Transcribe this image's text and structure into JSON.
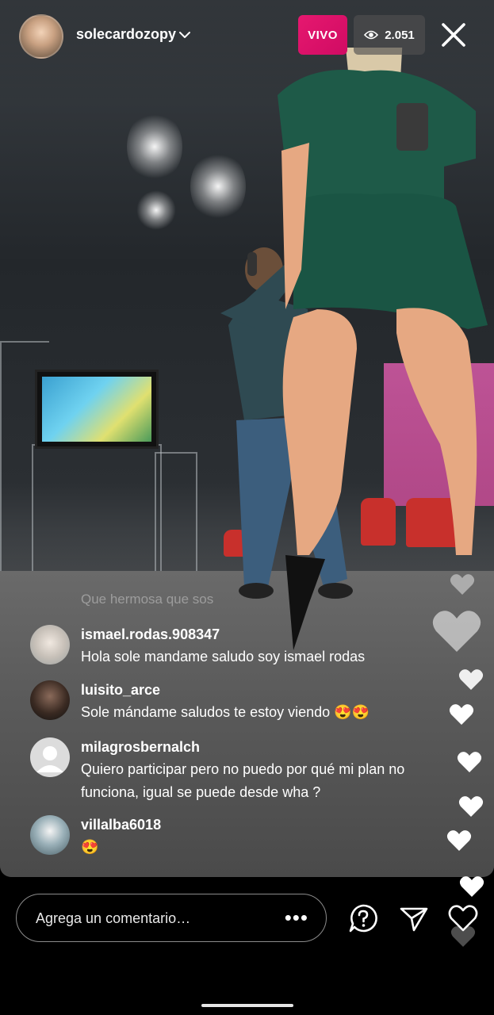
{
  "header": {
    "username": "solecardozopy",
    "live_label": "VIVO",
    "viewer_count": "2.051"
  },
  "comments": {
    "faded": "Que hermosa que sos",
    "items": [
      {
        "user": "ismael.rodas.908347",
        "text": "Hola sole mandame saludo soy ismael rodas"
      },
      {
        "user": "luisito_arce",
        "text": "Sole mándame saludos te estoy viendo 😍😍"
      },
      {
        "user": "milagrosbernalch",
        "text": "Quiero participar pero no puedo por qué mi plan no funciona, igual se puede desde wha ?"
      },
      {
        "user": "villalba6018",
        "text": "😍"
      }
    ]
  },
  "composer": {
    "placeholder": "Agrega un comentario…",
    "more_label": "•••"
  },
  "icons": {
    "live_badge_color": "#e6186f",
    "heart": "heart-icon",
    "question": "question-bubble-icon",
    "send": "paper-plane-icon",
    "eye": "eye-icon",
    "close": "close-icon"
  }
}
